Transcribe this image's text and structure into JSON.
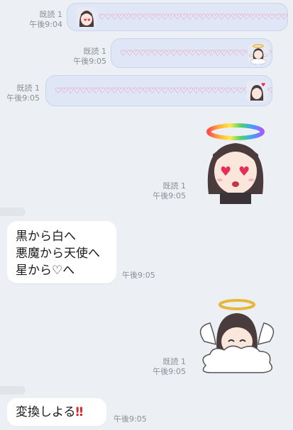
{
  "messages": [
    {
      "id": "m1",
      "side": "self",
      "read": "既読 1",
      "time": "午後9:04",
      "content": "♡♡♡♡♡♡♡♡♡♡♡♡♡♡♡♡♡♡♡♡♡♡♡♡♡♡♡♡♡♡♡♡♡♡"
    },
    {
      "id": "m2",
      "side": "self",
      "read": "既読 1",
      "time": "午後9:05",
      "content": "♡♡♡♡♡♡♡♡♡♡♡♡♡♡♡♡♡♡♡♡♡♡♡♡♡♡♡♡♡♡♡♡♡♡"
    },
    {
      "id": "m3",
      "side": "self",
      "read": "既読 1",
      "time": "午後9:05",
      "content": "♡♡♡♡♡♡♡♡♡♡♡♡♡♡♡♡♡♡♡♡♡♡♡♡♡♡♡♡♡♡♡♡♡♡♡♡♡♡♡♡♡"
    },
    {
      "id": "m4",
      "side": "self",
      "read": "既読 1",
      "time": "午後9:05",
      "sticker": "girl-rainbow-halo-heart-eyes"
    },
    {
      "id": "m5",
      "side": "other",
      "time": "午後9:05",
      "lines": [
        "黒から白へ",
        "悪魔から天使へ",
        "星から♡へ"
      ]
    },
    {
      "id": "m6",
      "side": "self",
      "read": "既読 1",
      "time": "午後9:05",
      "sticker": "angel-girl-on-cloud"
    },
    {
      "id": "m7",
      "side": "other",
      "time": "午後9:05",
      "text": "変換しよる",
      "emoji": "‼"
    }
  ],
  "colors": {
    "background": "#eceff3",
    "self_bubble": "#dfe7f6",
    "heart": "#ff4f86",
    "meta": "#8a9097"
  }
}
